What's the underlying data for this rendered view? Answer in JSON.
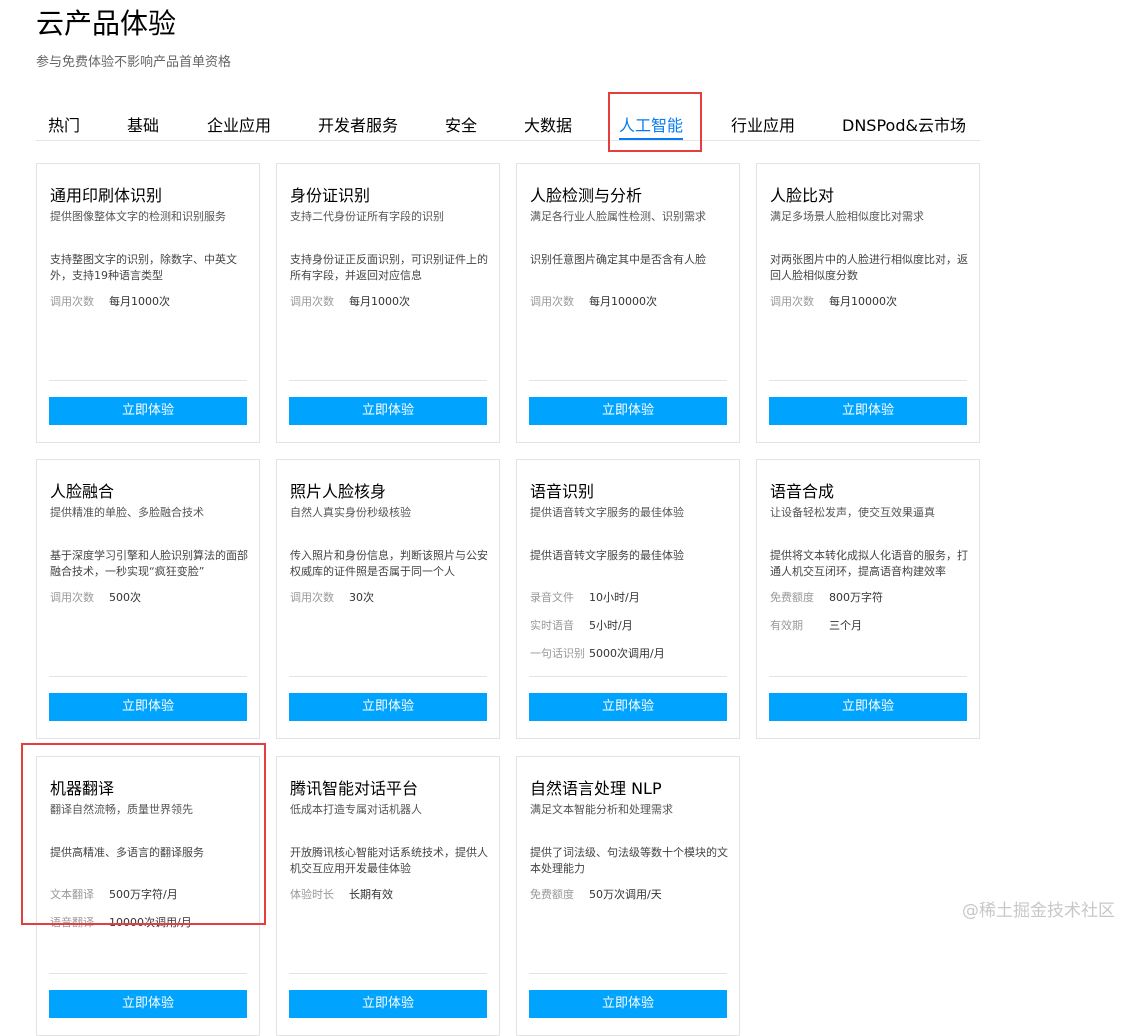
{
  "header": {
    "title": "云产品体验",
    "subtitle": "参与免费体验不影响产品首单资格"
  },
  "tabs": [
    "热门",
    "基础",
    "企业应用",
    "开发者服务",
    "安全",
    "大数据",
    "人工智能",
    "行业应用",
    "DNSPod&云市场"
  ],
  "active_tab": "人工智能",
  "cards": [
    {
      "name": "通用印刷体识别",
      "desc": "提供图像整体文字的检测和识别服务",
      "detail": "支持整图文字的识别，除数字、中英文外，支持19种语言类型",
      "quotas": [
        {
          "k": "调用次数",
          "v": "每月1000次"
        }
      ],
      "button": "立即体验"
    },
    {
      "name": "身份证识别",
      "desc": "支持二代身份证所有字段的识别",
      "detail": "支持身份证正反面识别，可识别证件上的所有字段，并返回对应信息",
      "quotas": [
        {
          "k": "调用次数",
          "v": "每月1000次"
        }
      ],
      "button": "立即体验"
    },
    {
      "name": "人脸检测与分析",
      "desc": "满足各行业人脸属性检测、识别需求",
      "detail": "识别任意图片确定其中是否含有人脸",
      "quotas": [
        {
          "k": "调用次数",
          "v": "每月10000次"
        }
      ],
      "button": "立即体验"
    },
    {
      "name": "人脸比对",
      "desc": "满足多场景人脸相似度比对需求",
      "detail": "对两张图片中的人脸进行相似度比对，返回人脸相似度分数",
      "quotas": [
        {
          "k": "调用次数",
          "v": "每月10000次"
        }
      ],
      "button": "立即体验"
    },
    {
      "name": "人脸融合",
      "desc": "提供精准的单脸、多脸融合技术",
      "detail": "基于深度学习引擎和人脸识别算法的面部融合技术，一秒实现“疯狂变脸”",
      "quotas": [
        {
          "k": "调用次数",
          "v": "500次"
        }
      ],
      "button": "立即体验"
    },
    {
      "name": "照片人脸核身",
      "desc": "自然人真实身份秒级核验",
      "detail": "传入照片和身份信息，判断该照片与公安权威库的证件照是否属于同一个人",
      "quotas": [
        {
          "k": "调用次数",
          "v": "30次"
        }
      ],
      "button": "立即体验"
    },
    {
      "name": "语音识别",
      "desc": "提供语音转文字服务的最佳体验",
      "detail": "提供语音转文字服务的最佳体验",
      "quotas": [
        {
          "k": "录音文件",
          "v": "10小时/月"
        },
        {
          "k": "实时语音",
          "v": "5小时/月"
        },
        {
          "k": "一句话识别",
          "v": "5000次调用/月"
        }
      ],
      "button": "立即体验"
    },
    {
      "name": "语音合成",
      "desc": "让设备轻松发声，使交互效果逼真",
      "detail": "提供将文本转化成拟人化语音的服务，打通人机交互闭环，提高语音构建效率",
      "quotas": [
        {
          "k": "免费额度",
          "v": "800万字符"
        },
        {
          "k": "有效期",
          "v": "三个月"
        }
      ],
      "button": "立即体验"
    },
    {
      "name": "机器翻译",
      "desc": "翻译自然流畅，质量世界领先",
      "detail": "提供高精准、多语言的翻译服务",
      "quotas": [
        {
          "k": "文本翻译",
          "v": "500万字符/月"
        },
        {
          "k": "语音翻译",
          "v": "10000次调用/月"
        }
      ],
      "button": "立即体验"
    },
    {
      "name": "腾讯智能对话平台",
      "desc": "低成本打造专属对话机器人",
      "detail": "开放腾讯核心智能对话系统技术，提供人机交互应用开发最佳体验",
      "quotas": [
        {
          "k": "体验时长",
          "v": "长期有效"
        }
      ],
      "button": "立即体验"
    },
    {
      "name": "自然语言处理 NLP",
      "desc": "满足文本智能分析和处理需求",
      "detail": "提供了词法级、句法级等数十个模块的文本处理能力",
      "quotas": [
        {
          "k": "免费额度",
          "v": "50万次调用/天"
        }
      ],
      "button": "立即体验"
    }
  ],
  "watermark": "@稀土掘金技术社区",
  "colors": {
    "accent": "#0a7cf1",
    "button": "#00a4ff",
    "highlight": "#e53e3e"
  }
}
